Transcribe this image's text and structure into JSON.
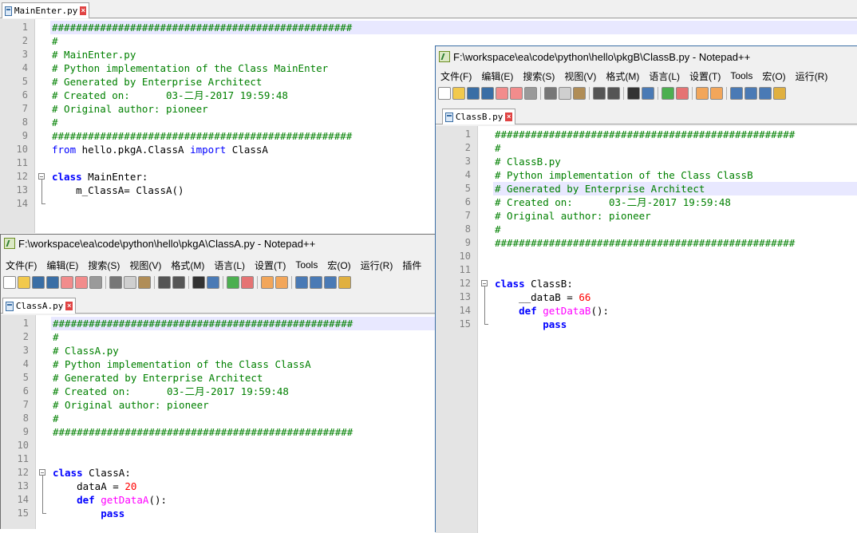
{
  "back_editor": {
    "tab_label": "MainEnter.py",
    "lines": [
      {
        "n": "1",
        "segs": [
          {
            "t": "##################################################",
            "c": "cmt"
          }
        ]
      },
      {
        "n": "2",
        "segs": [
          {
            "t": "#",
            "c": "cmt"
          }
        ]
      },
      {
        "n": "3",
        "segs": [
          {
            "t": "# MainEnter.py",
            "c": "cmt"
          }
        ]
      },
      {
        "n": "4",
        "segs": [
          {
            "t": "# Python implementation of the Class MainEnter",
            "c": "cmt"
          }
        ]
      },
      {
        "n": "5",
        "segs": [
          {
            "t": "# Generated by Enterprise Architect",
            "c": "cmt"
          }
        ]
      },
      {
        "n": "6",
        "segs": [
          {
            "t": "# Created on:      03-二月-2017 19:59:48",
            "c": "cmt"
          }
        ]
      },
      {
        "n": "7",
        "segs": [
          {
            "t": "# Original author: pioneer",
            "c": "cmt"
          }
        ]
      },
      {
        "n": "8",
        "segs": [
          {
            "t": "#",
            "c": "cmt"
          }
        ]
      },
      {
        "n": "9",
        "segs": [
          {
            "t": "##################################################",
            "c": "cmt"
          }
        ]
      },
      {
        "n": "10",
        "segs": [
          {
            "t": "from",
            "c": "kw2"
          },
          {
            "t": " hello.pkgA.ClassA ",
            "c": ""
          },
          {
            "t": "import",
            "c": "kw2"
          },
          {
            "t": " ClassA",
            "c": ""
          }
        ]
      },
      {
        "n": "11",
        "segs": []
      },
      {
        "n": "12",
        "segs": [
          {
            "t": "class",
            "c": "kw"
          },
          {
            "t": " MainEnter:",
            "c": ""
          }
        ]
      },
      {
        "n": "13",
        "segs": [
          {
            "t": "    m_ClassA= ClassA()",
            "c": ""
          }
        ]
      },
      {
        "n": "14",
        "segs": []
      }
    ]
  },
  "window_a": {
    "title": "F:\\workspace\\ea\\code\\python\\hello\\pkgA\\ClassA.py - Notepad++",
    "menu": [
      "文件(F)",
      "编辑(E)",
      "搜索(S)",
      "视图(V)",
      "格式(M)",
      "语言(L)",
      "设置(T)",
      "Tools",
      "宏(O)",
      "运行(R)",
      "插件"
    ],
    "tab_label": "ClassA.py",
    "lines": [
      {
        "n": "1",
        "segs": [
          {
            "t": "##################################################",
            "c": "cmt"
          }
        ]
      },
      {
        "n": "2",
        "segs": [
          {
            "t": "#",
            "c": "cmt"
          }
        ]
      },
      {
        "n": "3",
        "segs": [
          {
            "t": "# ClassA.py",
            "c": "cmt"
          }
        ]
      },
      {
        "n": "4",
        "segs": [
          {
            "t": "# Python implementation of the Class ClassA",
            "c": "cmt"
          }
        ]
      },
      {
        "n": "5",
        "segs": [
          {
            "t": "# Generated by Enterprise Architect",
            "c": "cmt"
          }
        ]
      },
      {
        "n": "6",
        "segs": [
          {
            "t": "# Created on:      03-二月-2017 19:59:48",
            "c": "cmt"
          }
        ]
      },
      {
        "n": "7",
        "segs": [
          {
            "t": "# Original author: pioneer",
            "c": "cmt"
          }
        ]
      },
      {
        "n": "8",
        "segs": [
          {
            "t": "#",
            "c": "cmt"
          }
        ]
      },
      {
        "n": "9",
        "segs": [
          {
            "t": "##################################################",
            "c": "cmt"
          }
        ]
      },
      {
        "n": "10",
        "segs": []
      },
      {
        "n": "11",
        "segs": []
      },
      {
        "n": "12",
        "segs": [
          {
            "t": "class",
            "c": "kw"
          },
          {
            "t": " ClassA:",
            "c": ""
          }
        ]
      },
      {
        "n": "13",
        "segs": [
          {
            "t": "    dataA = ",
            "c": ""
          },
          {
            "t": "20",
            "c": "num"
          }
        ]
      },
      {
        "n": "14",
        "segs": [
          {
            "t": "    ",
            "c": ""
          },
          {
            "t": "def",
            "c": "kw"
          },
          {
            "t": " ",
            "c": ""
          },
          {
            "t": "getDataA",
            "c": "fn"
          },
          {
            "t": "():",
            "c": ""
          }
        ]
      },
      {
        "n": "15",
        "segs": [
          {
            "t": "        ",
            "c": ""
          },
          {
            "t": "pass",
            "c": "kw"
          }
        ]
      }
    ]
  },
  "window_b": {
    "title": "F:\\workspace\\ea\\code\\python\\hello\\pkgB\\ClassB.py - Notepad++",
    "menu": [
      "文件(F)",
      "编辑(E)",
      "搜索(S)",
      "视图(V)",
      "格式(M)",
      "语言(L)",
      "设置(T)",
      "Tools",
      "宏(O)",
      "运行(R)"
    ],
    "tab_label": "ClassB.py",
    "lines": [
      {
        "n": "1",
        "segs": [
          {
            "t": "##################################################",
            "c": "cmt"
          }
        ]
      },
      {
        "n": "2",
        "segs": [
          {
            "t": "#",
            "c": "cmt"
          }
        ]
      },
      {
        "n": "3",
        "segs": [
          {
            "t": "# ClassB.py",
            "c": "cmt"
          }
        ]
      },
      {
        "n": "4",
        "segs": [
          {
            "t": "# Python implementation of the Class ClassB",
            "c": "cmt"
          }
        ]
      },
      {
        "n": "5",
        "segs": [
          {
            "t": "# Generated by Enterprise Architect",
            "c": "cmt"
          }
        ]
      },
      {
        "n": "6",
        "segs": [
          {
            "t": "# Created on:      03-二月-2017 19:59:48",
            "c": "cmt"
          }
        ]
      },
      {
        "n": "7",
        "segs": [
          {
            "t": "# Original author: pioneer",
            "c": "cmt"
          }
        ]
      },
      {
        "n": "8",
        "segs": [
          {
            "t": "#",
            "c": "cmt"
          }
        ]
      },
      {
        "n": "9",
        "segs": [
          {
            "t": "##################################################",
            "c": "cmt"
          }
        ]
      },
      {
        "n": "10",
        "segs": []
      },
      {
        "n": "11",
        "segs": []
      },
      {
        "n": "12",
        "segs": [
          {
            "t": "class",
            "c": "kw"
          },
          {
            "t": " ClassB:",
            "c": ""
          }
        ]
      },
      {
        "n": "13",
        "segs": [
          {
            "t": "    __dataB = ",
            "c": ""
          },
          {
            "t": "66",
            "c": "num"
          }
        ]
      },
      {
        "n": "14",
        "segs": [
          {
            "t": "    ",
            "c": ""
          },
          {
            "t": "def",
            "c": "kw"
          },
          {
            "t": " ",
            "c": ""
          },
          {
            "t": "getDataB",
            "c": "fn"
          },
          {
            "t": "():",
            "c": ""
          }
        ]
      },
      {
        "n": "15",
        "segs": [
          {
            "t": "        ",
            "c": ""
          },
          {
            "t": "pass",
            "c": "kw"
          }
        ]
      }
    ]
  },
  "toolbar_icons": [
    "new-file-icon",
    "open-file-icon",
    "save-icon",
    "save-all-icon",
    "close-icon",
    "close-all-icon",
    "print-icon",
    "sep",
    "cut-icon",
    "copy-icon",
    "paste-icon",
    "sep",
    "undo-icon",
    "redo-icon",
    "sep",
    "find-icon",
    "replace-icon",
    "sep",
    "zoom-in-icon",
    "zoom-out-icon",
    "sep",
    "sync-v-icon",
    "sync-h-icon",
    "sep",
    "wrap-icon",
    "show-all-icon",
    "indent-guide-icon",
    "panel-icon"
  ],
  "colors": {
    "comment": "#008000",
    "keyword": "#0000ff",
    "function": "#ff00ff",
    "number": "#ff0000",
    "gutter": "#e4e4e4",
    "current_line": "#e8e8ff"
  }
}
